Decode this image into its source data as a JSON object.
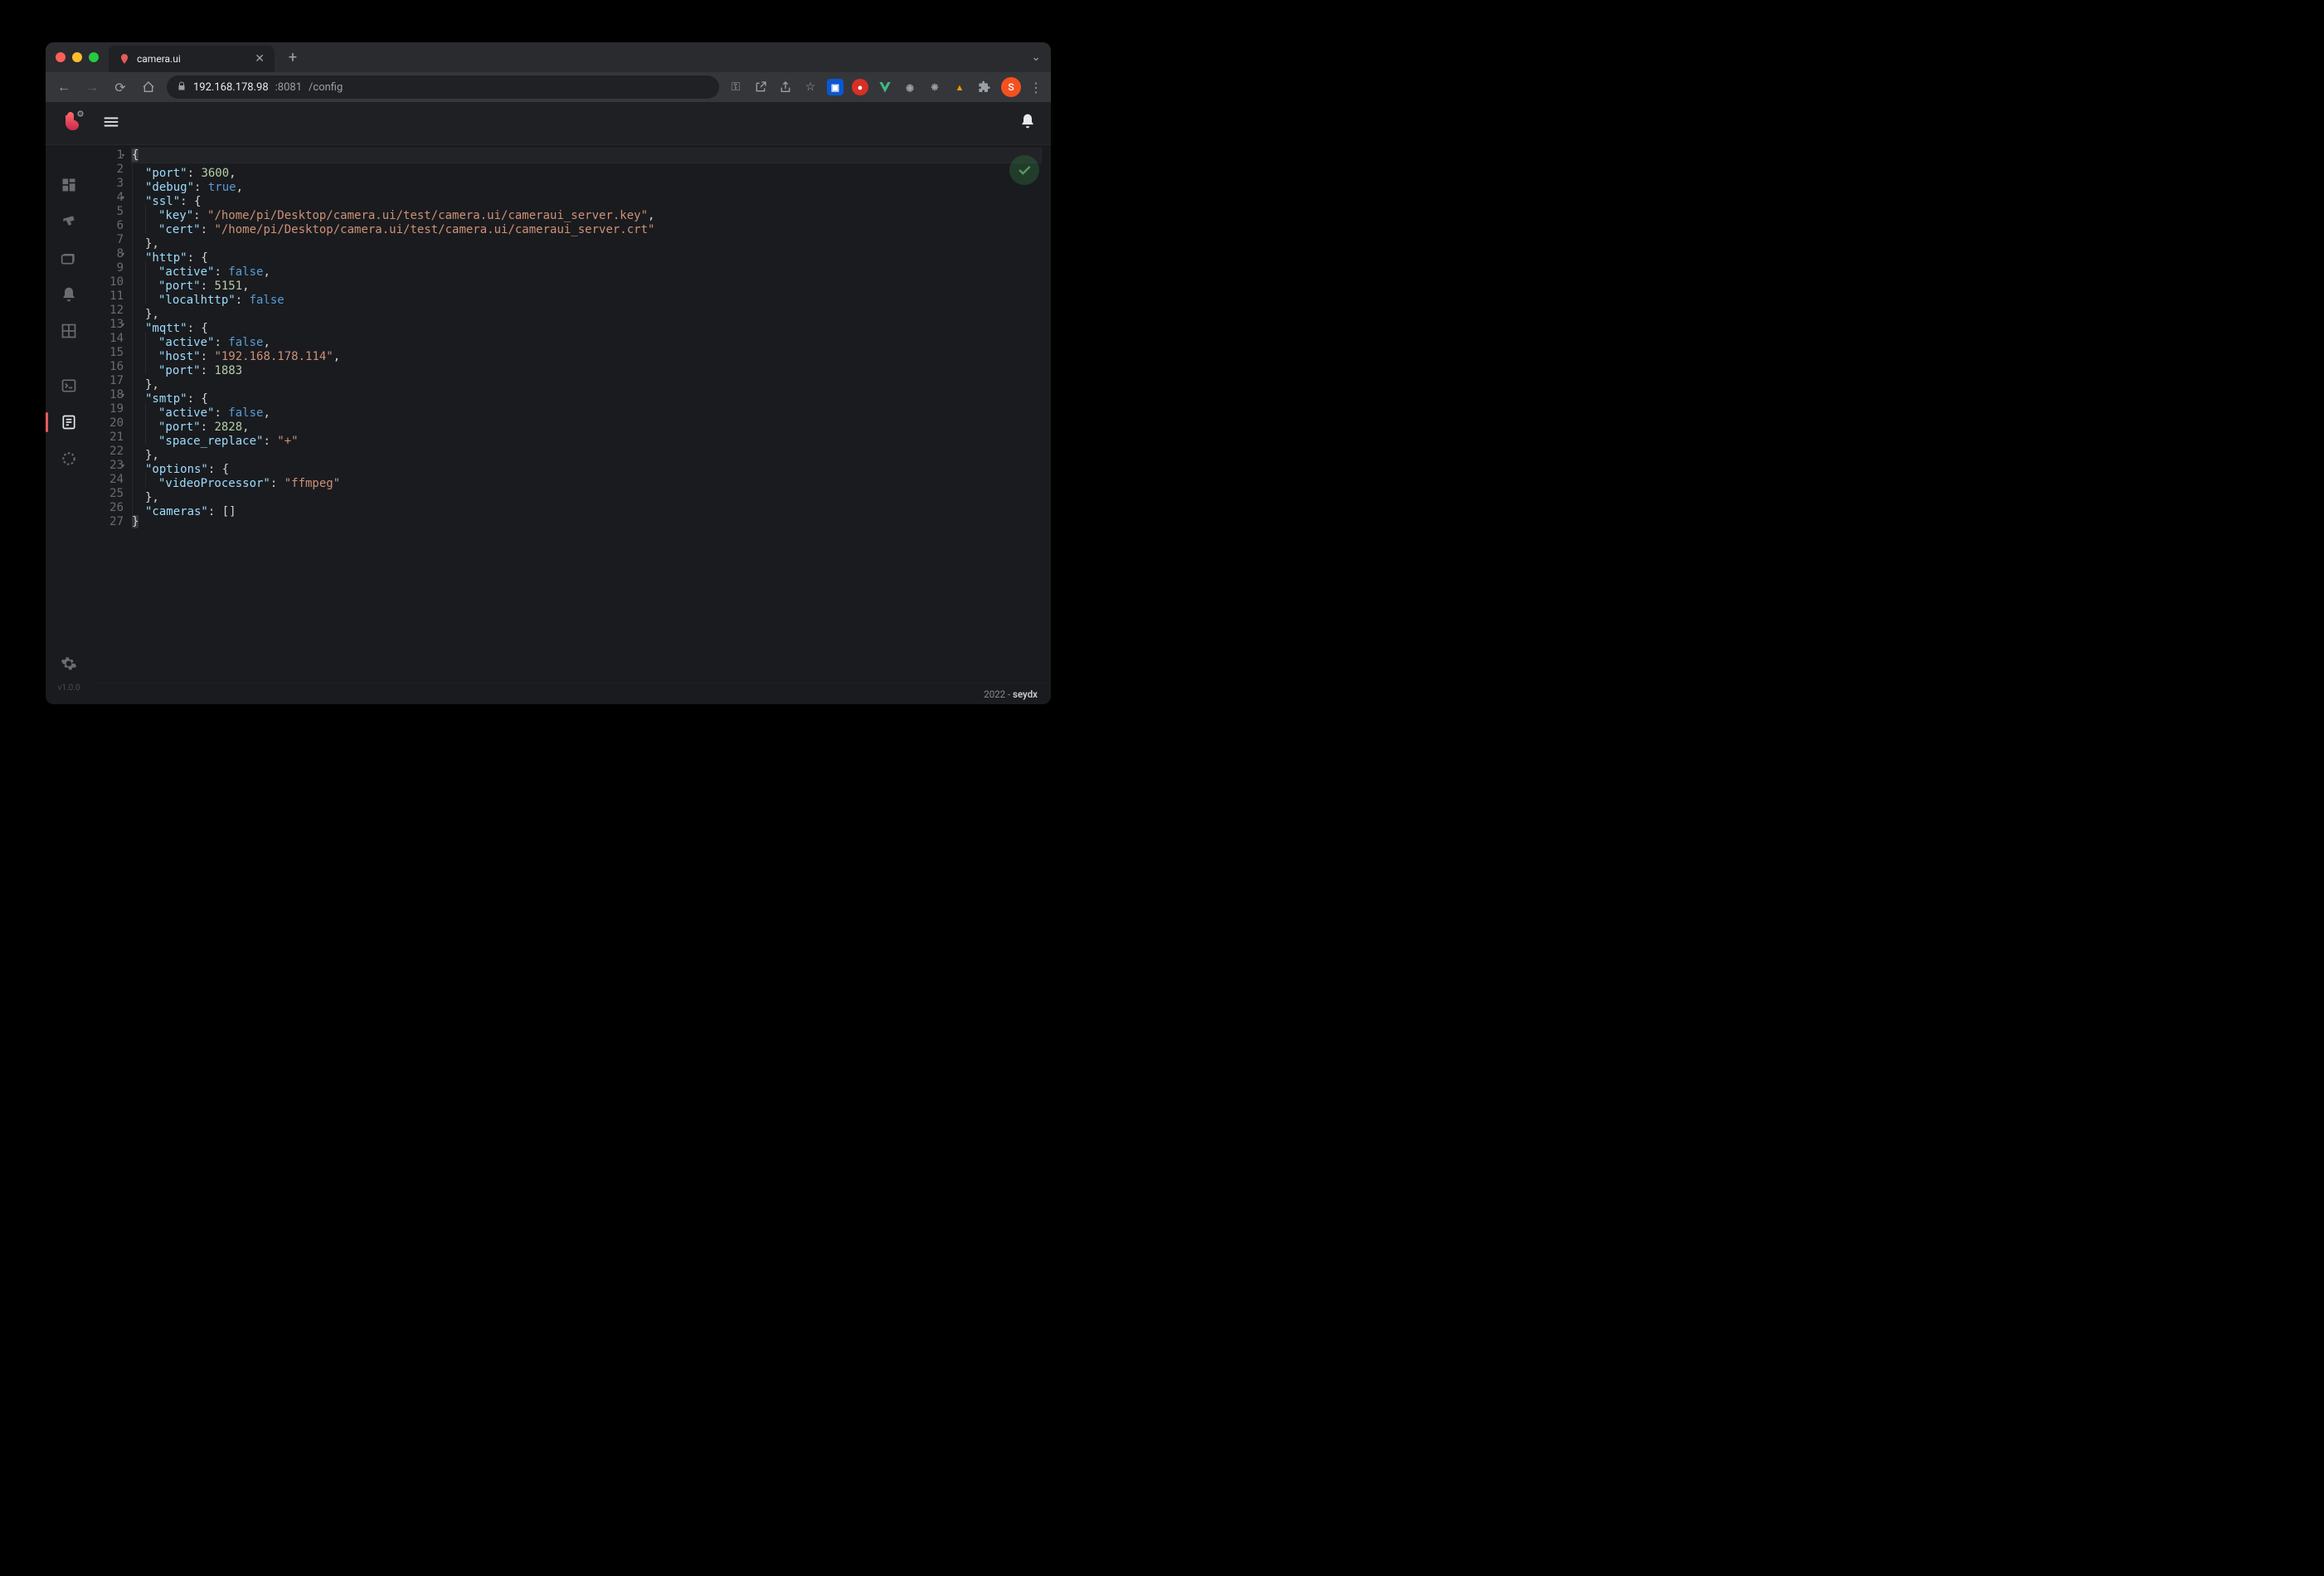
{
  "browser": {
    "tab_title": "camera.ui",
    "url_host": "192.168.178.98",
    "url_port": ":8081",
    "url_path": "/config",
    "avatar_letter": "S"
  },
  "sidebar": {
    "items": [
      {
        "name": "dashboard-icon"
      },
      {
        "name": "camera-icon"
      },
      {
        "name": "recordings-icon"
      },
      {
        "name": "notifications-icon"
      },
      {
        "name": "camview-icon"
      },
      {
        "name": "console-icon"
      },
      {
        "name": "config-icon"
      },
      {
        "name": "utilization-icon"
      }
    ],
    "version": "v1.0.0"
  },
  "editor": {
    "lines": [
      {
        "n": 1,
        "fold": true,
        "indent": 0,
        "active": true,
        "tokens": [
          {
            "t": "bh",
            "v": "{"
          }
        ]
      },
      {
        "n": 2,
        "indent": 1,
        "tokens": [
          {
            "t": "k",
            "v": "\"port\""
          },
          {
            "t": "p",
            "v": ": "
          },
          {
            "t": "n",
            "v": "3600"
          },
          {
            "t": "p",
            "v": ","
          }
        ]
      },
      {
        "n": 3,
        "indent": 1,
        "tokens": [
          {
            "t": "k",
            "v": "\"debug\""
          },
          {
            "t": "p",
            "v": ": "
          },
          {
            "t": "b",
            "v": "true"
          },
          {
            "t": "p",
            "v": ","
          }
        ]
      },
      {
        "n": 4,
        "fold": true,
        "indent": 1,
        "tokens": [
          {
            "t": "k",
            "v": "\"ssl\""
          },
          {
            "t": "p",
            "v": ": {"
          }
        ]
      },
      {
        "n": 5,
        "indent": 2,
        "tokens": [
          {
            "t": "k",
            "v": "\"key\""
          },
          {
            "t": "p",
            "v": ": "
          },
          {
            "t": "s",
            "v": "\"/home/pi/Desktop/camera.ui/test/camera.ui/cameraui_server.key\""
          },
          {
            "t": "p",
            "v": ","
          }
        ]
      },
      {
        "n": 6,
        "indent": 2,
        "tokens": [
          {
            "t": "k",
            "v": "\"cert\""
          },
          {
            "t": "p",
            "v": ": "
          },
          {
            "t": "s",
            "v": "\"/home/pi/Desktop/camera.ui/test/camera.ui/cameraui_server.crt\""
          }
        ]
      },
      {
        "n": 7,
        "indent": 1,
        "tokens": [
          {
            "t": "p",
            "v": "},"
          }
        ]
      },
      {
        "n": 8,
        "fold": true,
        "indent": 1,
        "tokens": [
          {
            "t": "k",
            "v": "\"http\""
          },
          {
            "t": "p",
            "v": ": {"
          }
        ]
      },
      {
        "n": 9,
        "indent": 2,
        "tokens": [
          {
            "t": "k",
            "v": "\"active\""
          },
          {
            "t": "p",
            "v": ": "
          },
          {
            "t": "b",
            "v": "false"
          },
          {
            "t": "p",
            "v": ","
          }
        ]
      },
      {
        "n": 10,
        "indent": 2,
        "tokens": [
          {
            "t": "k",
            "v": "\"port\""
          },
          {
            "t": "p",
            "v": ": "
          },
          {
            "t": "n",
            "v": "5151"
          },
          {
            "t": "p",
            "v": ","
          }
        ]
      },
      {
        "n": 11,
        "indent": 2,
        "tokens": [
          {
            "t": "k",
            "v": "\"localhttp\""
          },
          {
            "t": "p",
            "v": ": "
          },
          {
            "t": "b",
            "v": "false"
          }
        ]
      },
      {
        "n": 12,
        "indent": 1,
        "tokens": [
          {
            "t": "p",
            "v": "},"
          }
        ]
      },
      {
        "n": 13,
        "fold": true,
        "indent": 1,
        "tokens": [
          {
            "t": "k",
            "v": "\"mqtt\""
          },
          {
            "t": "p",
            "v": ": {"
          }
        ]
      },
      {
        "n": 14,
        "indent": 2,
        "tokens": [
          {
            "t": "k",
            "v": "\"active\""
          },
          {
            "t": "p",
            "v": ": "
          },
          {
            "t": "b",
            "v": "false"
          },
          {
            "t": "p",
            "v": ","
          }
        ]
      },
      {
        "n": 15,
        "indent": 2,
        "tokens": [
          {
            "t": "k",
            "v": "\"host\""
          },
          {
            "t": "p",
            "v": ": "
          },
          {
            "t": "s",
            "v": "\"192.168.178.114\""
          },
          {
            "t": "p",
            "v": ","
          }
        ]
      },
      {
        "n": 16,
        "indent": 2,
        "tokens": [
          {
            "t": "k",
            "v": "\"port\""
          },
          {
            "t": "p",
            "v": ": "
          },
          {
            "t": "n",
            "v": "1883"
          }
        ]
      },
      {
        "n": 17,
        "indent": 1,
        "tokens": [
          {
            "t": "p",
            "v": "},"
          }
        ]
      },
      {
        "n": 18,
        "fold": true,
        "indent": 1,
        "tokens": [
          {
            "t": "k",
            "v": "\"smtp\""
          },
          {
            "t": "p",
            "v": ": {"
          }
        ]
      },
      {
        "n": 19,
        "indent": 2,
        "tokens": [
          {
            "t": "k",
            "v": "\"active\""
          },
          {
            "t": "p",
            "v": ": "
          },
          {
            "t": "b",
            "v": "false"
          },
          {
            "t": "p",
            "v": ","
          }
        ]
      },
      {
        "n": 20,
        "indent": 2,
        "tokens": [
          {
            "t": "k",
            "v": "\"port\""
          },
          {
            "t": "p",
            "v": ": "
          },
          {
            "t": "n",
            "v": "2828"
          },
          {
            "t": "p",
            "v": ","
          }
        ]
      },
      {
        "n": 21,
        "indent": 2,
        "tokens": [
          {
            "t": "k",
            "v": "\"space_replace\""
          },
          {
            "t": "p",
            "v": ": "
          },
          {
            "t": "s",
            "v": "\"+\""
          }
        ]
      },
      {
        "n": 22,
        "indent": 1,
        "tokens": [
          {
            "t": "p",
            "v": "},"
          }
        ]
      },
      {
        "n": 23,
        "fold": true,
        "indent": 1,
        "tokens": [
          {
            "t": "k",
            "v": "\"options\""
          },
          {
            "t": "p",
            "v": ": {"
          }
        ]
      },
      {
        "n": 24,
        "indent": 2,
        "tokens": [
          {
            "t": "k",
            "v": "\"videoProcessor\""
          },
          {
            "t": "p",
            "v": ": "
          },
          {
            "t": "s",
            "v": "\"ffmpeg\""
          }
        ]
      },
      {
        "n": 25,
        "indent": 1,
        "tokens": [
          {
            "t": "p",
            "v": "},"
          }
        ]
      },
      {
        "n": 26,
        "indent": 1,
        "tokens": [
          {
            "t": "k",
            "v": "\"cameras\""
          },
          {
            "t": "p",
            "v": ": []"
          }
        ]
      },
      {
        "n": 27,
        "indent": 0,
        "tokens": [
          {
            "t": "bh",
            "v": "}"
          }
        ]
      }
    ]
  },
  "footer": {
    "year": "2022",
    "author": "seydx"
  }
}
